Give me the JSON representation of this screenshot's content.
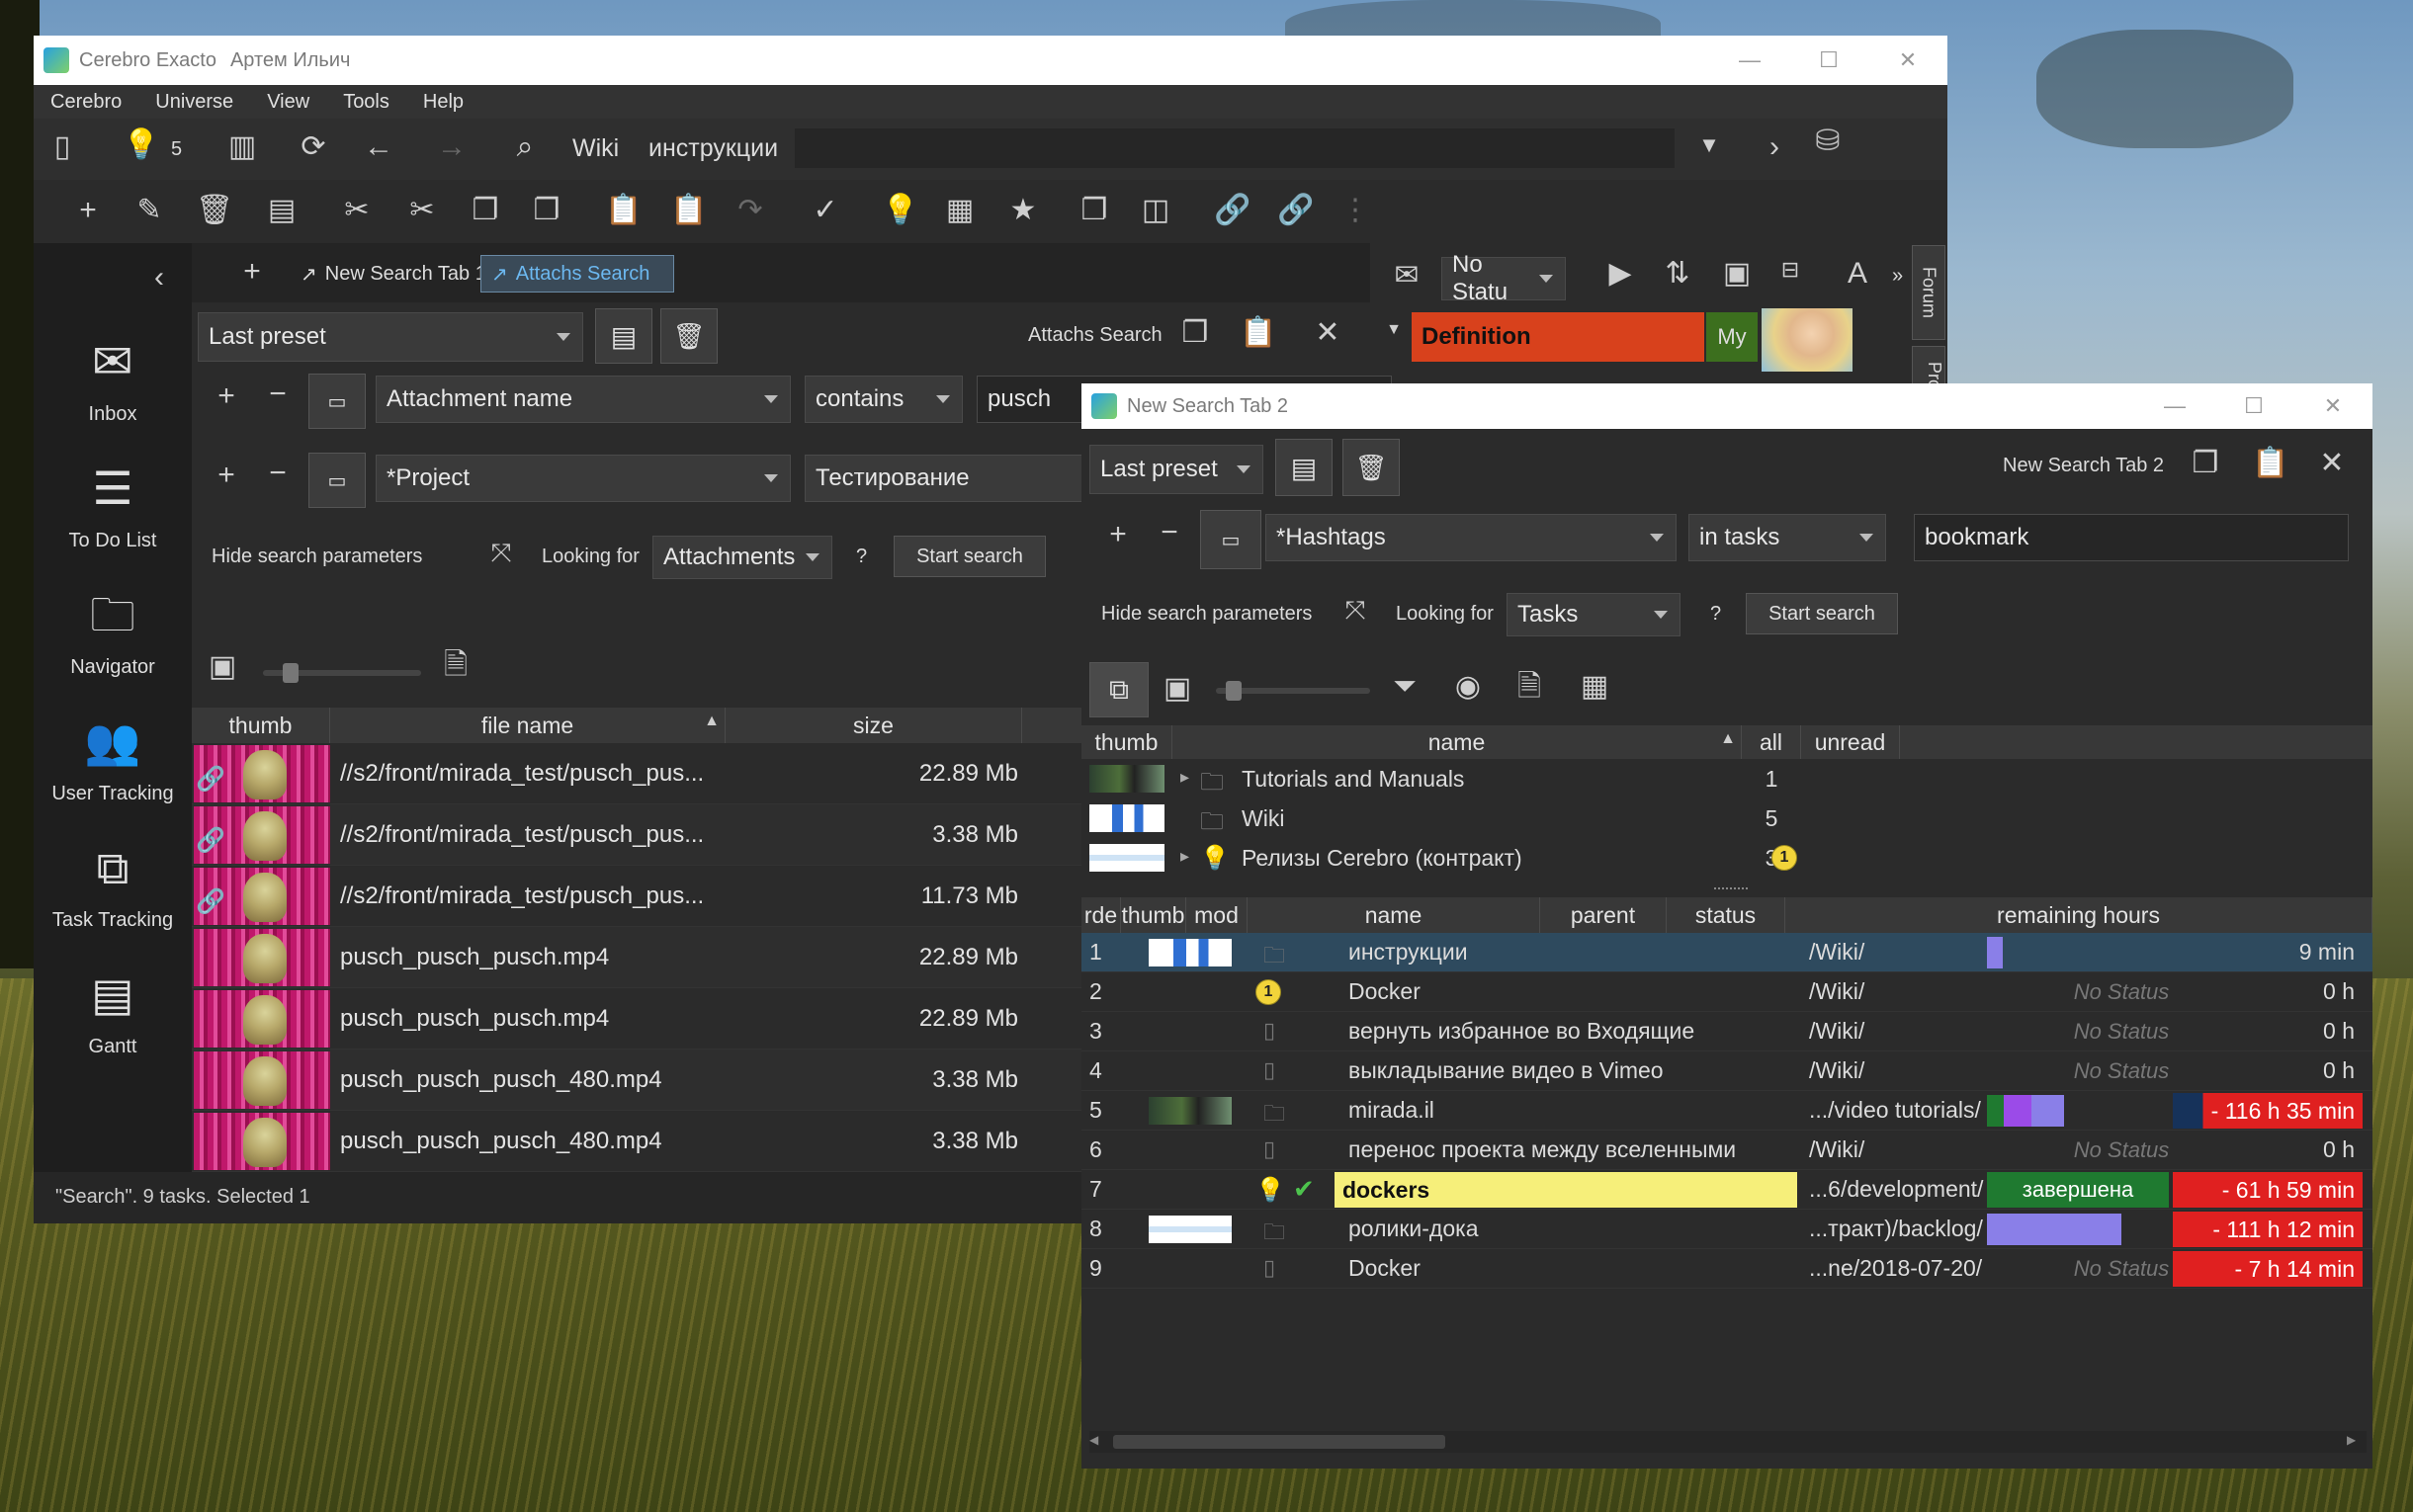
{
  "app": {
    "title": "Cerebro Exacto",
    "user": "Артем Ильич"
  },
  "menu": [
    "Cerebro",
    "Universe",
    "View",
    "Tools",
    "Help"
  ],
  "toolbar": {
    "bulb_count": "5",
    "crumbs": [
      "Wiki",
      "инструкции"
    ]
  },
  "sidebar": {
    "items": [
      {
        "label": "Inbox",
        "icon": "inbox-icon"
      },
      {
        "label": "To Do List",
        "icon": "todo-list-icon"
      },
      {
        "label": "Navigator",
        "icon": "folder-icon"
      },
      {
        "label": "User Tracking",
        "icon": "user-tracking-icon"
      },
      {
        "label": "Task Tracking",
        "icon": "task-tracking-icon"
      },
      {
        "label": "Gantt",
        "icon": "gantt-icon"
      }
    ]
  },
  "tabs": [
    {
      "label": "New Search Tab 1",
      "active": false
    },
    {
      "label": "Attachs Search",
      "active": true
    }
  ],
  "attachs": {
    "preset": "Last preset",
    "title": "Attachs Search",
    "criteria": [
      {
        "field": "Attachment name",
        "op": "contains",
        "value": "pusch"
      },
      {
        "field": "*Project",
        "op": "Тестирование",
        "value": ""
      }
    ],
    "hide_params": "Hide search parameters",
    "looking_for_label": "Looking for",
    "looking_for": "Attachments",
    "help": "?",
    "start": "Start search",
    "columns": [
      "thumb",
      "file name",
      "size"
    ],
    "rows": [
      {
        "name": "//s2/front/mirada_test/pusch_pus...",
        "size": "22.89 Mb",
        "linked": true
      },
      {
        "name": "//s2/front/mirada_test/pusch_pus...",
        "size": "3.38 Mb",
        "linked": true
      },
      {
        "name": "//s2/front/mirada_test/pusch_pus...",
        "size": "11.73 Mb",
        "linked": true
      },
      {
        "name": "pusch_pusch_pusch.mp4",
        "size": "22.89 Mb",
        "linked": false
      },
      {
        "name": "pusch_pusch_pusch.mp4",
        "size": "22.89 Mb",
        "linked": false
      },
      {
        "name": "pusch_pusch_pusch_480.mp4",
        "size": "3.38 Mb",
        "linked": false
      },
      {
        "name": "pusch_pusch_pusch_480.mp4",
        "size": "3.38 Mb",
        "linked": false
      }
    ],
    "status_bar": "\"Search\". 9 tasks. Selected 1"
  },
  "right_panel": {
    "status_select": "No Statu",
    "definition": "Definition",
    "my": "My",
    "forum": "Forum",
    "prop": "Prop"
  },
  "search2": {
    "window_title": "New Search Tab 2",
    "preset": "Last preset",
    "title": "New Search Tab 2",
    "criteria": {
      "field": "*Hashtags",
      "op": "in tasks",
      "value": "bookmark"
    },
    "hide_params": "Hide search parameters",
    "looking_for_label": "Looking for",
    "looking_for": "Tasks",
    "help": "?",
    "start": "Start search",
    "group_columns": [
      "thumb",
      "name",
      "all",
      "unread"
    ],
    "groups": [
      {
        "name": "Tutorials and Manuals",
        "all": "1",
        "unread": ""
      },
      {
        "name": "Wiki",
        "all": "5",
        "unread": ""
      },
      {
        "name": "Релизы Cerebro (контракт)",
        "all": "3",
        "unread": "1"
      }
    ],
    "task_columns": [
      "rde",
      "thumb",
      "mod",
      "name",
      "parent",
      "status",
      "remaining hours"
    ],
    "tasks": [
      {
        "order": "1",
        "name": "инструкции",
        "parent": "/Wiki/",
        "status": "",
        "remaining": "9 min"
      },
      {
        "order": "2",
        "name": "Docker",
        "parent": "/Wiki/",
        "status": "No Status",
        "remaining": "0 h"
      },
      {
        "order": "3",
        "name": "вернуть избранное во Входящие",
        "parent": "/Wiki/",
        "status": "No Status",
        "remaining": "0 h"
      },
      {
        "order": "4",
        "name": "выкладывание видео в Vimeo",
        "parent": "/Wiki/",
        "status": "No Status",
        "remaining": "0 h"
      },
      {
        "order": "5",
        "name": "mirada.il",
        "parent": ".../video tutorials/",
        "status": "",
        "remaining": "- 116 h 35 min"
      },
      {
        "order": "6",
        "name": "перенос проекта между вселенными",
        "parent": "/Wiki/",
        "status": "No Status",
        "remaining": "0 h"
      },
      {
        "order": "7",
        "name": "dockers",
        "parent": "...6/development/",
        "status": "завершена",
        "remaining": "- 61 h 59 min"
      },
      {
        "order": "8",
        "name": "ролики-дока",
        "parent": "...тракт)/backlog/",
        "status": "",
        "remaining": "- 111 h 12 min"
      },
      {
        "order": "9",
        "name": "Docker",
        "parent": "...ne/2018-07-20/",
        "status": "No Status",
        "remaining": "- 7 h 14 min"
      }
    ]
  },
  "colors": {
    "selection": "#2e4a5e",
    "overdue": "#e02020",
    "done_green": "#1f7a30",
    "highlight_yellow": "#f6ef7a",
    "progress": "#8a7fe8"
  }
}
